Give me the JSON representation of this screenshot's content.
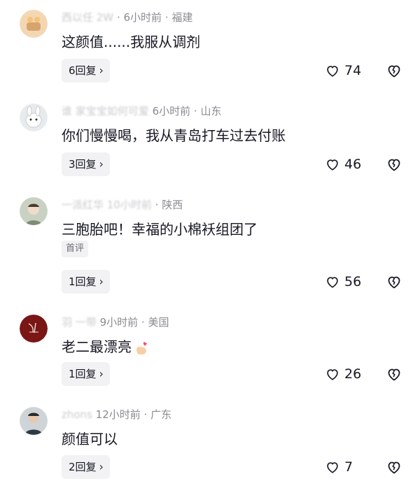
{
  "comments": [
    {
      "meta_blur": "西以任 2W",
      "meta_time": "6小时前",
      "meta_location": "福建",
      "text": "这颜值......我服从调剂",
      "badge": "",
      "reply_label": "6回复",
      "likes": "74",
      "avatar_color": "#f3d7b3"
    },
    {
      "meta_blur": "谁 家宝宝如何可爱",
      "meta_time": "6小时前",
      "meta_location": "山东",
      "text": "你们慢慢喝，我从青岛打车过去付账",
      "badge": "",
      "reply_label": "3回复",
      "likes": "46",
      "avatar_color": "#dfe3e6"
    },
    {
      "meta_blur": "一派红华 10小时前",
      "meta_time": "",
      "meta_location": "陕西",
      "text": "三胞胎吧！幸福的小棉袄组团了",
      "badge": "首评",
      "reply_label": "1回复",
      "likes": "56",
      "avatar_color": "#c9d2c2"
    },
    {
      "meta_blur": "羽 一带",
      "meta_time": "9小时前",
      "meta_location": "美国",
      "text": "老二最漂亮",
      "badge": "",
      "reply_label": "1回复",
      "likes": "26",
      "avatar_color": "#7a1616"
    },
    {
      "meta_blur": "zhons",
      "meta_time": "12小时前",
      "meta_location": "广东",
      "text": "颜值可以",
      "badge": "",
      "reply_label": "2回复",
      "likes": "7",
      "avatar_color": "#cfd4d8"
    }
  ],
  "icons": {
    "like": "heart-outline-icon",
    "dislike": "broken-heart-icon",
    "reply_arrow": "chevron-right-icon",
    "emoji": "finger-heart-emoji-icon"
  }
}
